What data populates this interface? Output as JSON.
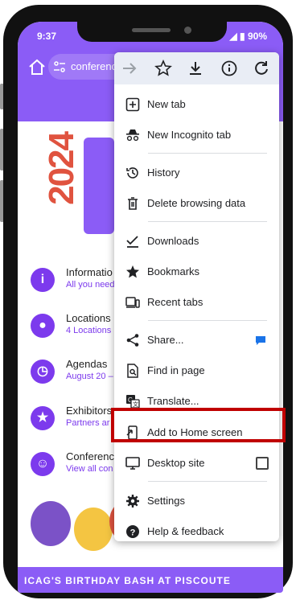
{
  "status": {
    "time": "9:37",
    "battery": "90%"
  },
  "toolbar": {
    "url": "conferenc"
  },
  "page": {
    "hero_year": "2024",
    "list": [
      {
        "title": "Informatio",
        "subtitle": "All you need",
        "icon": "info-icon"
      },
      {
        "title": "Locations",
        "subtitle": "4 Locations",
        "icon": "location-pin-icon"
      },
      {
        "title": "Agendas",
        "subtitle": "August 20 –",
        "icon": "clock-icon"
      },
      {
        "title": "Exhibitors",
        "subtitle": "Partners ar",
        "icon": "star-icon"
      },
      {
        "title": "Conference",
        "subtitle": "View all con",
        "icon": "people-icon"
      }
    ],
    "bottom_banner": "ICAG'S BIRTHDAY BASH AT PISCOUTE"
  },
  "menu": {
    "items": [
      {
        "label": "New tab",
        "icon": "new-tab-icon"
      },
      {
        "label": "New Incognito tab",
        "icon": "incognito-icon"
      },
      {
        "label": "History",
        "icon": "history-icon"
      },
      {
        "label": "Delete browsing data",
        "icon": "trash-icon"
      },
      {
        "label": "Downloads",
        "icon": "download-check-icon"
      },
      {
        "label": "Bookmarks",
        "icon": "star-icon"
      },
      {
        "label": "Recent tabs",
        "icon": "devices-icon"
      },
      {
        "label": "Share...",
        "icon": "share-icon"
      },
      {
        "label": "Find in page",
        "icon": "find-in-page-icon"
      },
      {
        "label": "Translate...",
        "icon": "translate-icon"
      },
      {
        "label": "Add to Home screen",
        "icon": "add-to-home-icon"
      },
      {
        "label": "Desktop site",
        "icon": "desktop-icon"
      },
      {
        "label": "Settings",
        "icon": "gear-icon"
      },
      {
        "label": "Help & feedback",
        "icon": "help-icon"
      }
    ],
    "desktop_site_checked": false
  },
  "colors": {
    "brand": "#8b5cf6",
    "highlight": "#c00000"
  }
}
